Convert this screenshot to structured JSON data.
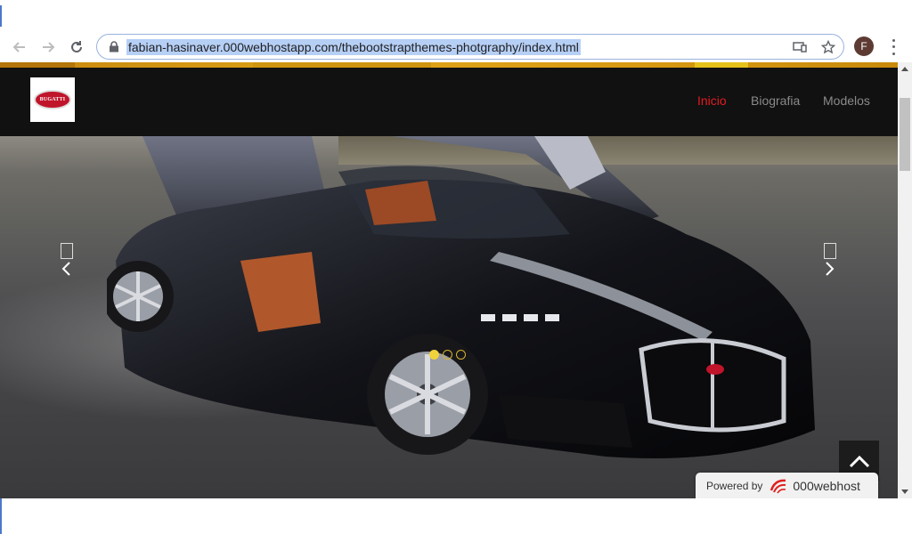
{
  "browser": {
    "url": "fabian-hasinaver.000webhostapp.com/thebootstrapthemes-photgraphy/index.html",
    "profile_initial": "F",
    "icons": {
      "back": "back-arrow-icon",
      "forward": "forward-arrow-icon",
      "reload": "reload-icon",
      "lock": "lock-icon",
      "cast": "cast-icon",
      "bookmark": "star-icon",
      "menu": "kebab-menu-icon"
    }
  },
  "site": {
    "logo_text": "BUGATTI",
    "nav": [
      {
        "label": "Inicio",
        "active": true
      },
      {
        "label": "Biografia",
        "active": false
      },
      {
        "label": "Modelos",
        "active": false
      }
    ],
    "carousel": {
      "slides": 3,
      "active_index": 0
    },
    "powered": {
      "label": "Powered by",
      "brand": "000webhost"
    },
    "colors": {
      "accent": "#e21b22",
      "stripe": "#e0a418",
      "navbar": "#111111"
    }
  }
}
